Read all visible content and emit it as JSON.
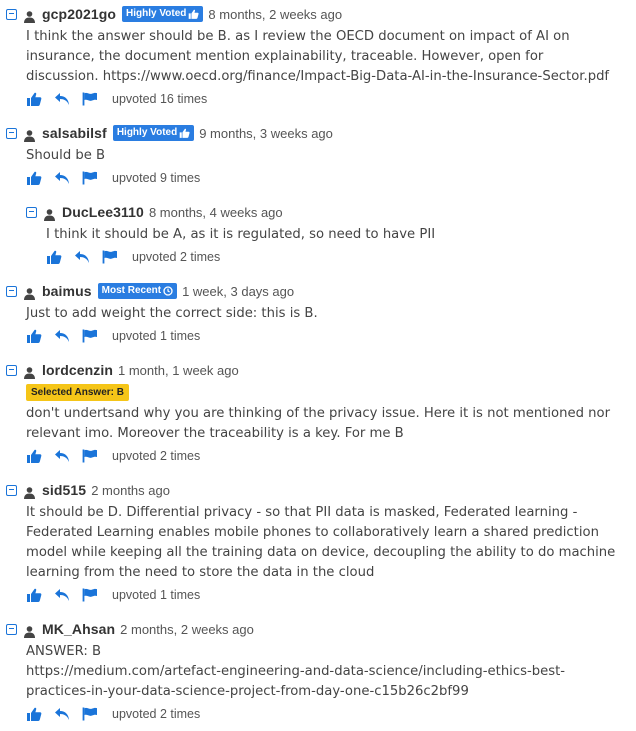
{
  "comments": [
    {
      "username": "gcp2021go",
      "badge": "Highly Voted",
      "date": "8 months, 2 weeks ago",
      "text": "I think the answer should be B. as I review the OECD document on impact of AI on insurance, the document mention explainability, traceable. However, open for discussion. https://www.oecd.org/finance/Impact-Big-Data-AI-in-the-Insurance-Sector.pdf",
      "upvotes": "upvoted 16 times",
      "reply": false
    },
    {
      "username": "salsabilsf",
      "badge": "Highly Voted",
      "date": "9 months, 3 weeks ago",
      "text": "Should be B",
      "upvotes": "upvoted 9 times",
      "reply": false
    },
    {
      "username": "DucLee3110",
      "date": "8 months, 4 weeks ago",
      "text": "I think it should be A, as it is regulated, so need to have PII",
      "upvotes": "upvoted 2 times",
      "reply": true
    },
    {
      "username": "baimus",
      "badge": "Most Recent",
      "date": "1 week, 3 days ago",
      "text": "Just to add weight the correct side: this is B.",
      "upvotes": "upvoted 1 times",
      "reply": false
    },
    {
      "username": "lordcenzin",
      "date": "1 month, 1 week ago",
      "selected": "Selected Answer: B",
      "text": "don't undertsand why you are thinking of the privacy issue. Here it is not mentioned nor relevant imo. Moreover the traceability is a key. For me B",
      "upvotes": "upvoted 2 times",
      "reply": false
    },
    {
      "username": "sid515",
      "date": "2 months ago",
      "text": "It should be D. Differential privacy - so that PII data is masked, Federated learning - Federated Learning enables mobile phones to collaboratively learn a shared prediction model while keeping all the training data on device, decoupling the ability to do machine learning from the need to store the data in the cloud",
      "upvotes": "upvoted 1 times",
      "reply": false
    },
    {
      "username": "MK_Ahsan",
      "date": "2 months, 2 weeks ago",
      "text": "ANSWER: B\nhttps://medium.com/artefact-engineering-and-data-science/including-ethics-best-practices-in-your-data-science-project-from-day-one-c15b26c2bf99",
      "upvotes": "upvoted 2 times",
      "reply": false
    }
  ],
  "icons": {
    "collapse": "minus-square-icon",
    "user": "user-icon",
    "upvote": "thumbs-up-icon",
    "reply": "reply-arrow-icon",
    "flag": "flag-icon",
    "badge_thumb": "thumbs-up-icon",
    "badge_clock": "clock-icon"
  },
  "colors": {
    "accent": "#1a74d9",
    "badge": "#2a7de1",
    "selected": "#f5c518"
  }
}
